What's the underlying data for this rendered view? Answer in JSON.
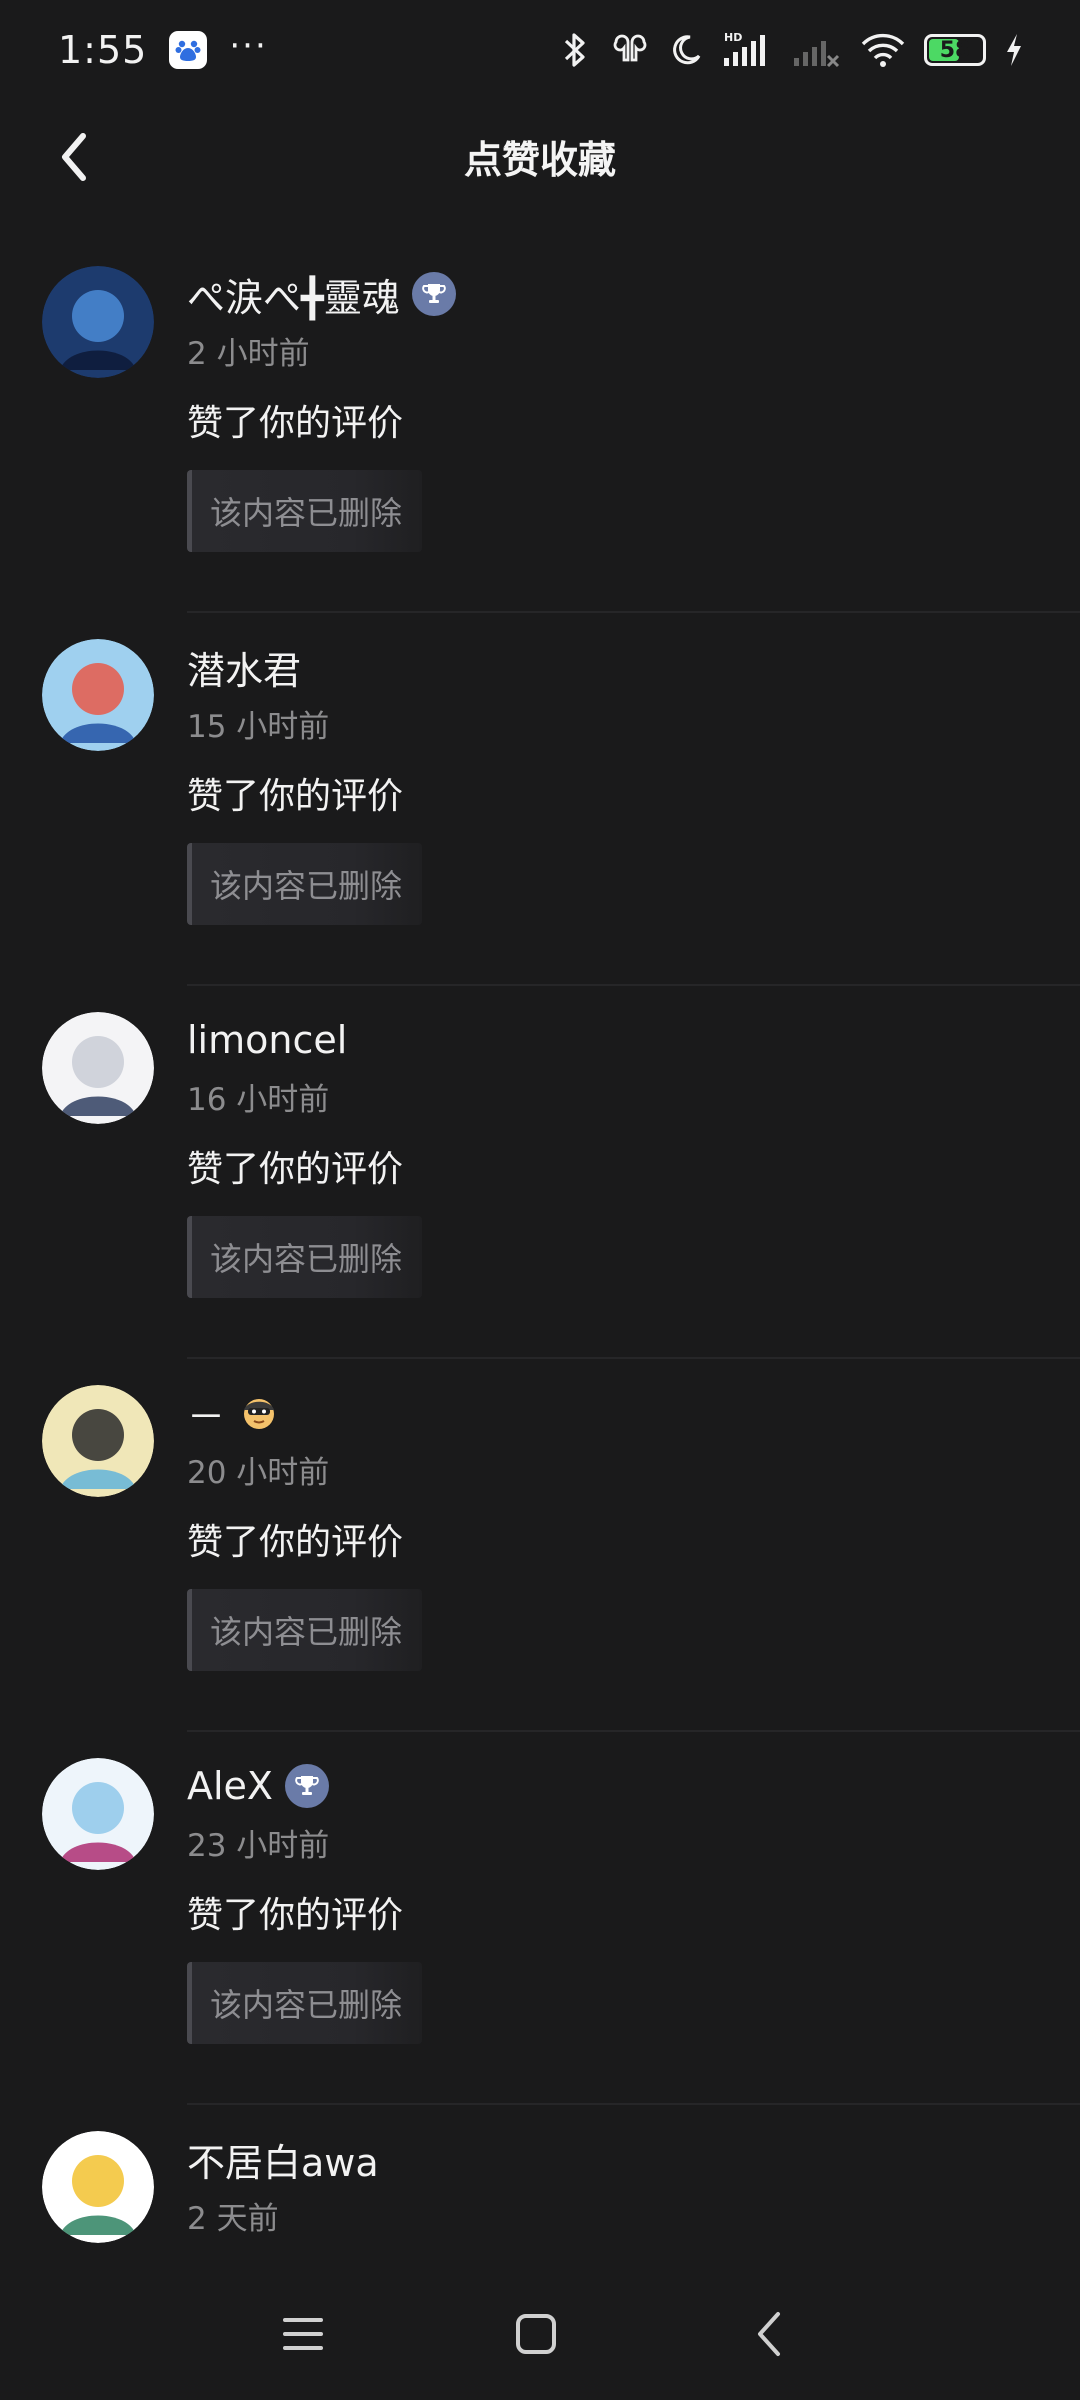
{
  "status_bar": {
    "time": "1:55",
    "more": "···",
    "battery": "58",
    "icons": [
      "baidu-app-icon",
      "bluetooth-icon",
      "earbuds-icon",
      "moon-icon",
      "hd-signal-icon",
      "no-signal-icon",
      "wifi-icon",
      "battery-icon",
      "charging-icon"
    ]
  },
  "header": {
    "title": "点赞收藏",
    "back_icon": "chevron-left-icon"
  },
  "items": [
    {
      "name": "ぺ涙ぺ╋靈魂",
      "badge": "trophy",
      "time": "2 小时前",
      "action": "赞了你的评价",
      "deleted": "该内容已删除",
      "avatar_colors": [
        "#1d3b6e",
        "#4a8bd6",
        "#0e1c3a"
      ]
    },
    {
      "name": "潜水君",
      "badge": "",
      "time": "15 小时前",
      "action": "赞了你的评价",
      "deleted": "该内容已删除",
      "avatar_colors": [
        "#9fd0ef",
        "#e85a4a",
        "#2a5aa8"
      ]
    },
    {
      "name": "limoncel",
      "badge": "",
      "time": "16 小时前",
      "action": "赞了你的评价",
      "deleted": "该内容已删除",
      "avatar_colors": [
        "#f4f4f6",
        "#c9ccd6",
        "#3c4a6a"
      ]
    },
    {
      "name": "－",
      "badge": "emoji",
      "time": "20 小时前",
      "action": "赞了你的评价",
      "deleted": "该内容已删除",
      "avatar_colors": [
        "#f0e7b8",
        "#2a2a2a",
        "#6ab7d8"
      ]
    },
    {
      "name": "AleX",
      "badge": "trophy",
      "time": "23 小时前",
      "action": "赞了你的评价",
      "deleted": "该内容已删除",
      "avatar_colors": [
        "#eef5fb",
        "#8fc8ea",
        "#b03a7a"
      ]
    },
    {
      "name": "不居白awa",
      "badge": "",
      "time": "2 天前",
      "action": "",
      "deleted": "",
      "avatar_colors": [
        "#ffffff",
        "#f2c230",
        "#3a8a6a"
      ]
    }
  ],
  "nav_bar": {
    "menu_icon": "menu-icon",
    "home_icon": "home-square-icon",
    "back_icon": "back-triangle-icon"
  },
  "colors": {
    "background": "#1a1a1b",
    "badge": "#6a7ba8",
    "secondary_text": "#8c8c8e"
  }
}
